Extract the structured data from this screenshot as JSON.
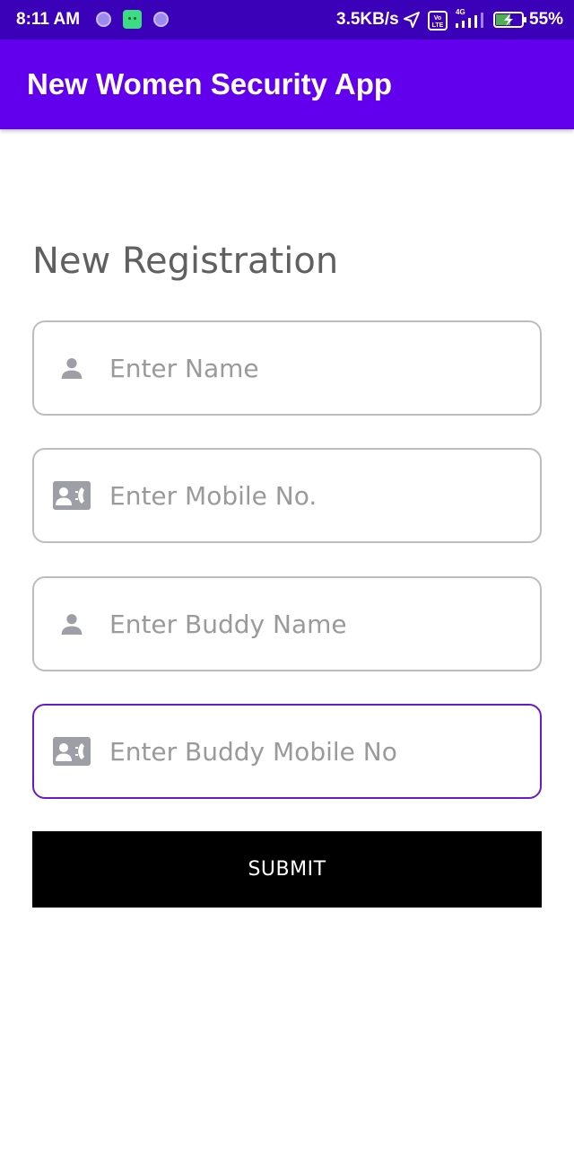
{
  "status_bar": {
    "time": "8:11 AM",
    "speed": "3.5KB/s",
    "network_label": "4G",
    "volte_label": "Vo LTE",
    "battery": "55%",
    "icons": [
      "notification-dot-icon",
      "android-icon",
      "notification-dot-icon",
      "navigation-arrow-icon",
      "volte-icon",
      "signal-icon",
      "battery-charging-icon"
    ]
  },
  "app_bar": {
    "title": "New Women Security App",
    "color": "#6200ee"
  },
  "form": {
    "heading": "New Registration",
    "fields": [
      {
        "placeholder": "Enter Name",
        "icon": "person-icon"
      },
      {
        "placeholder": "Enter Mobile No.",
        "icon": "contact-phone-icon"
      },
      {
        "placeholder": "Enter Buddy Name",
        "icon": "person-icon"
      },
      {
        "placeholder": "Enter Buddy Mobile No",
        "icon": "contact-phone-icon"
      }
    ],
    "focused_accent": "#6a1bc6",
    "submit_label": "SUBMIT"
  }
}
